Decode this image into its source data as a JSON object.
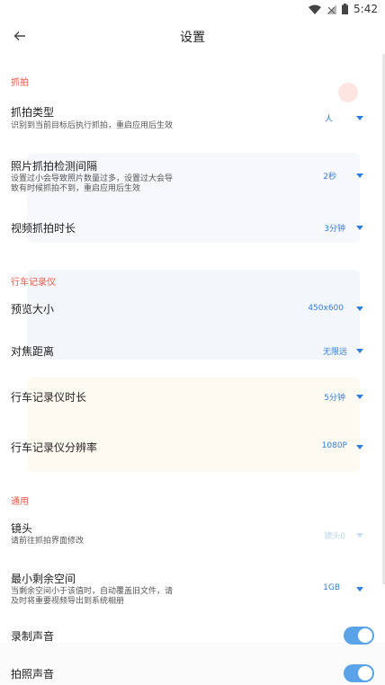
{
  "status": {
    "time": "5:42",
    "icons": [
      "wifi-icon",
      "signal-icon",
      "battery-icon"
    ]
  },
  "header": {
    "title": "设置",
    "back_icon": "arrow-left-icon"
  },
  "sections": [
    {
      "title": "抓拍",
      "items": [
        {
          "title": "抓拍类型",
          "subtitle": [
            "识别到当前目标后执行抓拍，重启应用后生效"
          ],
          "value": "人"
        },
        {
          "title": "照片抓拍检测间隔",
          "subtitle": [
            "设置过小会导致照片数量过多，设置过大会导",
            "致有时候抓拍不到，重启应用后生效"
          ],
          "value": "2秒"
        },
        {
          "title": "视频抓拍时长",
          "value": "3分钟"
        }
      ]
    },
    {
      "title": "行车记录仪",
      "items": [
        {
          "title": "预览大小",
          "value": "450x600"
        },
        {
          "title": "对焦距离",
          "value": "无限远"
        },
        {
          "title": "行车记录仪时长",
          "value": "5分钟"
        },
        {
          "title": "行车记录仪分辨率",
          "value": "1080P"
        }
      ]
    },
    {
      "title": "通用",
      "items": [
        {
          "title": "镜头",
          "subtitle": [
            "请前往抓拍界面修改"
          ],
          "value": "镜头0",
          "disabled": true
        },
        {
          "title": "最小剩余空间",
          "subtitle": [
            "当剩余空间小于该值时，自动覆盖旧文件，请",
            "及时将重要视频导出到系统相册"
          ],
          "value": "1GB"
        },
        {
          "title": "录制声音",
          "toggle": true
        },
        {
          "title": "拍照声音",
          "toggle": true
        }
      ]
    }
  ],
  "colors": {
    "accent": "#2f7de1",
    "section": "#e85a4a",
    "toggle": "#5ba3e8"
  }
}
